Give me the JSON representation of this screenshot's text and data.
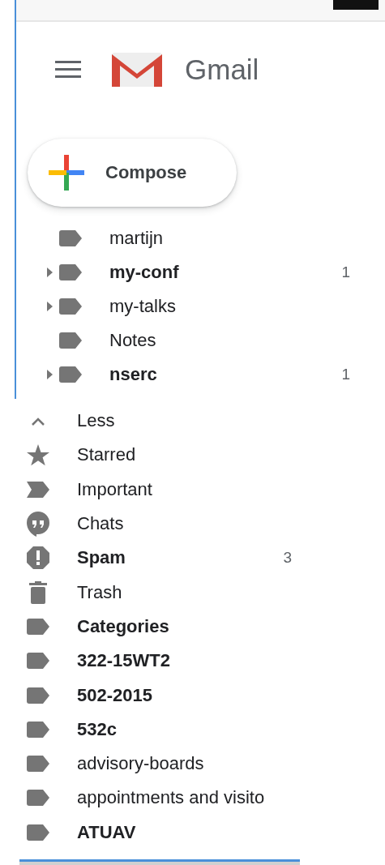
{
  "header": {
    "title": "Gmail"
  },
  "compose": {
    "label": "Compose"
  },
  "labels": [
    {
      "name": "martijn",
      "unread": false,
      "expandable": false
    },
    {
      "name": "my-conf",
      "unread": true,
      "expandable": true,
      "count": "1"
    },
    {
      "name": "my-talks",
      "unread": false,
      "expandable": true
    },
    {
      "name": "Notes",
      "unread": false,
      "expandable": false
    },
    {
      "name": "nserc",
      "unread": true,
      "expandable": true,
      "count": "1"
    }
  ],
  "more": [
    {
      "kind": "less",
      "name": "Less",
      "unread": false
    },
    {
      "kind": "starred",
      "name": "Starred",
      "unread": false
    },
    {
      "kind": "important",
      "name": "Important",
      "unread": false
    },
    {
      "kind": "chats",
      "name": "Chats",
      "unread": false
    },
    {
      "kind": "spam",
      "name": "Spam",
      "unread": true,
      "count": "3"
    },
    {
      "kind": "trash",
      "name": "Trash",
      "unread": false
    },
    {
      "kind": "label",
      "name": "Categories",
      "unread": true
    },
    {
      "kind": "label",
      "name": "322-15WT2",
      "unread": true
    },
    {
      "kind": "label",
      "name": "502-2015",
      "unread": true
    },
    {
      "kind": "label",
      "name": "532c",
      "unread": true
    },
    {
      "kind": "label",
      "name": "advisory-boards",
      "unread": false
    },
    {
      "kind": "label",
      "name": "appointments and visito",
      "unread": false
    },
    {
      "kind": "label",
      "name": "ATUAV",
      "unread": true
    }
  ]
}
